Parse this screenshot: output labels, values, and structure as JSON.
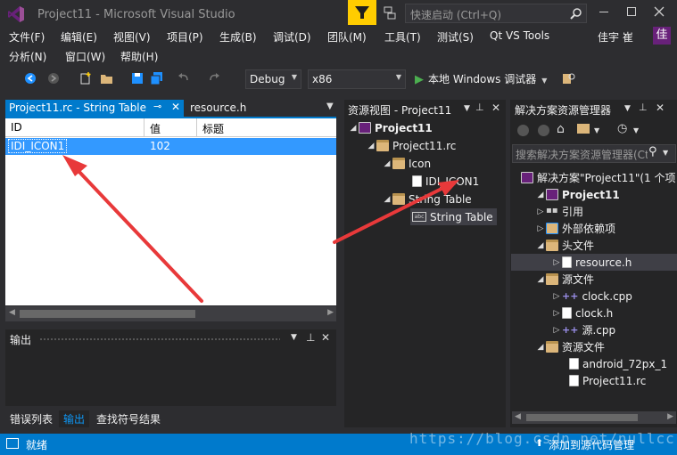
{
  "window": {
    "title": "Project11 - Microsoft Visual Studio",
    "quick_launch_placeholder": "快速启动 (Ctrl+Q)",
    "user": "佳宇 崔",
    "user_badge": "佳"
  },
  "menu_row1": [
    "文件(F)",
    "编辑(E)",
    "视图(V)",
    "项目(P)",
    "生成(B)",
    "调试(D)",
    "团队(M)",
    "工具(T)",
    "测试(S)",
    "Qt VS Tools"
  ],
  "menu_row2": [
    "分析(N)",
    "窗口(W)",
    "帮助(H)"
  ],
  "toolbar": {
    "config": "Debug",
    "platform": "x86",
    "run_label": "本地 Windows 调试器"
  },
  "editor": {
    "tabs": [
      {
        "label": "Project11.rc - String Table",
        "active": true
      },
      {
        "label": "resource.h",
        "active": false
      }
    ],
    "columns": [
      "ID",
      "值",
      "标题"
    ],
    "rows": [
      {
        "id": "IDI_ICON1",
        "value": "102",
        "caption": ""
      }
    ]
  },
  "output": {
    "title": "输出"
  },
  "bottom_tabs": [
    "错误列表",
    "输出",
    "查找符号结果"
  ],
  "resource_view": {
    "title": "资源视图 - Project11",
    "items": [
      "Project11",
      "Project11.rc",
      "Icon",
      "IDI_ICON1",
      "String Table",
      "String Table"
    ]
  },
  "solution_explorer": {
    "title": "解决方案资源管理器",
    "search_placeholder": "搜索解决方案资源管理器(Ctrl+;)",
    "items": [
      "解决方案\"Project11\"(1 个项",
      "Project11",
      "引用",
      "外部依赖项",
      "头文件",
      "resource.h",
      "源文件",
      "clock.cpp",
      "clock.h",
      "源.cpp",
      "资源文件",
      "android_72px_1",
      "Project11.rc"
    ]
  },
  "status": {
    "left": "就绪",
    "right": "添加到源代码管理",
    "watermark": "https://blog.csdn.net/nullcc"
  },
  "colors": {
    "accent": "#007acc",
    "selection": "#3399ff",
    "arrow": "#e8393a",
    "filter": "#ffcc00"
  }
}
